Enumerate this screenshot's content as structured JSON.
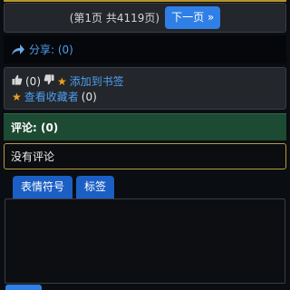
{
  "pager": {
    "info": "(第1页 共4119页)",
    "next_label": "下一页 »"
  },
  "share": {
    "label": "分享: (0)",
    "icon": "share-arrow-icon"
  },
  "actions": {
    "like_count": "(0)",
    "like_icon": "thumbs-up-icon",
    "dislike_icon": "thumbs-down-icon",
    "bookmark_label": "添加到书签",
    "view_favorites_label": "查看收藏者",
    "favorites_count": "(0)",
    "star_icon": "star-icon"
  },
  "comments": {
    "header": "评论: (0)",
    "empty_text": "没有评论"
  },
  "editor_tabs": {
    "emoji_label": "表情符号",
    "tags_label": "标签"
  },
  "colors": {
    "accent": "#2f7fe6",
    "link": "#4e9ff0",
    "comments_bar": "#1d4a32",
    "panel": "#23262b"
  }
}
